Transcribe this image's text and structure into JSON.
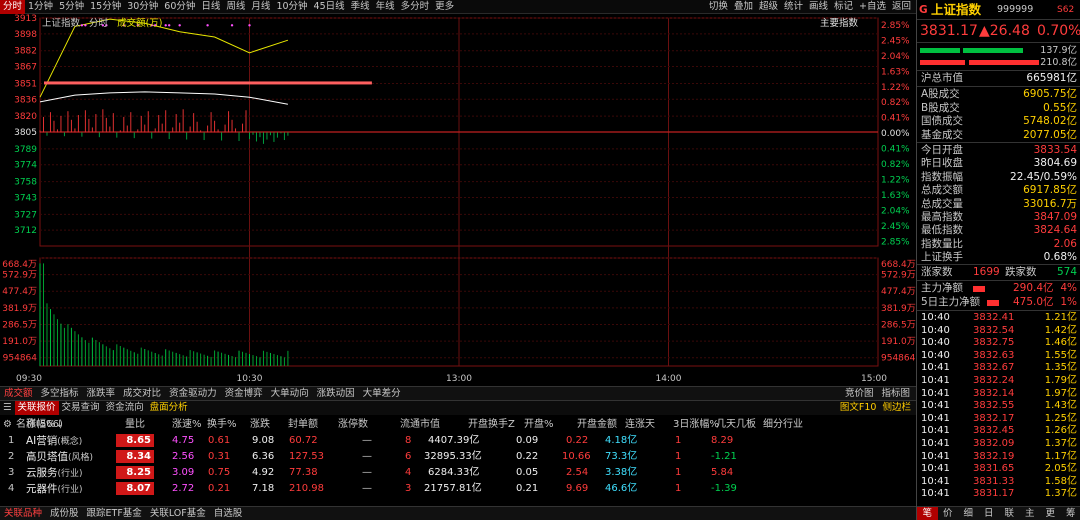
{
  "periods": [
    "分时",
    "1分钟",
    "5分钟",
    "15分钟",
    "30分钟",
    "60分钟",
    "日线",
    "周线",
    "月线",
    "10分钟",
    "45日线",
    "季线",
    "年线",
    "多分时",
    "更多"
  ],
  "active_period": 0,
  "tools": [
    "切换",
    "叠加",
    "超级",
    "统计",
    "画线",
    "标记",
    "+自选",
    "返回"
  ],
  "chart": {
    "legend_name": "上证指数",
    "legend_mode": "分时",
    "legend_vol": "成交额(万)",
    "index_label": "主要指数",
    "price_ticks": [
      "3913",
      "3898",
      "3882",
      "3867",
      "3851",
      "3836",
      "3820",
      "3805",
      "3789",
      "3774",
      "3758",
      "3743",
      "3727",
      "3712"
    ],
    "pct_ticks": [
      "2.85%",
      "2.45%",
      "2.04%",
      "1.63%",
      "1.22%",
      "0.82%",
      "0.41%",
      "0.00%",
      "0.41%",
      "0.82%",
      "1.22%",
      "1.63%",
      "2.04%",
      "2.45%",
      "2.85%"
    ],
    "vol_ticks": [
      "668.4万",
      "572.9万",
      "477.4万",
      "381.9万",
      "286.5万",
      "191.0万",
      "954864"
    ],
    "time_ticks": [
      "09:30",
      "10:30",
      "13:00",
      "14:00",
      "15:00"
    ]
  },
  "chart_data": {
    "type": "line",
    "title": "上证指数",
    "xlabel": "",
    "ylabel": "",
    "prev_close": 3804.69,
    "ylim": [
      3697,
      3913
    ],
    "x": [
      "09:30",
      "09:40",
      "09:50",
      "10:00",
      "10:10",
      "10:20",
      "10:30",
      "10:41"
    ],
    "series": [
      {
        "name": "",
        "color": "#ffffff",
        "values": [
          3833.5,
          3840,
          3842,
          3843,
          3842,
          3841,
          3838,
          3831.2
        ]
      },
      {
        "name": "",
        "color": "#e6e600",
        "values": [
          3838,
          3905,
          3912,
          3908,
          3900,
          3895,
          3880,
          3892
        ]
      }
    ],
    "volume_ylim": [
      0,
      668.4
    ],
    "volume_unit": "万"
  },
  "subtabs": [
    "成交额",
    "多空指标",
    "涨跌率",
    "成交对比",
    "资金驱动力",
    "资金博弈",
    "大单动向",
    "涨跌动因",
    "大单差分"
  ],
  "subtabs_right": [
    "竞价图",
    "指标图"
  ],
  "tabs2": [
    "关联报价",
    "交易查询",
    "资金流向",
    "盘面分析"
  ],
  "tabs2_right": [
    "图文F10",
    "侧边栏"
  ],
  "table": {
    "headers": [
      "名称(566)",
      "涨幅%↓",
      "量比",
      "涨速%",
      "换手%",
      "涨跌",
      "封单额",
      "涨停数",
      "流通市值",
      "开盘换手Z",
      "开盘%",
      "开盘金额",
      "连涨天",
      "3日涨幅%",
      "几天几板",
      "细分行业"
    ],
    "rows": [
      {
        "no": "1",
        "name": "AI营销",
        "tag": "(概念)",
        "chg": "8.65",
        "vr": "4.75",
        "spd": "0.61",
        "turn": "9.08",
        "delta": "60.72",
        "seal": "—",
        "lim": "8",
        "cap": "4407.39亿",
        "oturn": "0.09",
        "opct": "0.22",
        "oamt": "4.18亿",
        "days": "1",
        "d3": "8.29",
        "d3c": "red"
      },
      {
        "no": "2",
        "name": "高贝塔值",
        "tag": "(风格)",
        "chg": "8.34",
        "vr": "2.56",
        "spd": "0.31",
        "turn": "6.36",
        "delta": "127.53",
        "seal": "—",
        "lim": "6",
        "cap": "32895.33亿",
        "oturn": "0.22",
        "opct": "10.66",
        "oamt": "73.3亿",
        "days": "1",
        "d3": "-1.21",
        "d3c": "grn"
      },
      {
        "no": "3",
        "name": "云服务",
        "tag": "(行业)",
        "chg": "8.25",
        "vr": "3.09",
        "spd": "0.75",
        "turn": "4.92",
        "delta": "77.38",
        "seal": "—",
        "lim": "4",
        "cap": "6284.33亿",
        "oturn": "0.05",
        "opct": "2.54",
        "oamt": "3.38亿",
        "days": "1",
        "d3": "5.84",
        "d3c": "red"
      },
      {
        "no": "4",
        "name": "元器件",
        "tag": "(行业)",
        "chg": "8.07",
        "vr": "2.72",
        "spd": "0.21",
        "turn": "7.18",
        "delta": "210.98",
        "seal": "—",
        "lim": "3",
        "cap": "21757.81亿",
        "oturn": "0.21",
        "opct": "9.69",
        "oamt": "46.6亿",
        "days": "1",
        "d3": "-1.39",
        "d3c": "grn"
      }
    ]
  },
  "bottom_tabs": [
    "关联品种",
    "成份股",
    "跟踪ETF基金",
    "关联LOF基金",
    "自选股"
  ],
  "right": {
    "flag": "G",
    "title": "上证指数",
    "code": "999999",
    "sig": "S62",
    "price": "3831.17",
    "change": "▲26.48",
    "pct": "0.70%",
    "bar1_val": "137.9亿",
    "bar2_val": "210.8亿",
    "market_cap_label": "沪总市值",
    "market_cap": "665981亿",
    "vol_rows": [
      {
        "label": "A股成交",
        "value": "6905.75亿"
      },
      {
        "label": "B股成交",
        "value": "0.55亿"
      },
      {
        "label": "国债成交",
        "value": "5748.02亿"
      },
      {
        "label": "基金成交",
        "value": "2077.05亿"
      }
    ],
    "stats": [
      {
        "label": "今日开盘",
        "value": "3833.54",
        "c": "red"
      },
      {
        "label": "昨日收盘",
        "value": "3804.69",
        "c": "wht"
      },
      {
        "label": "指数振幅",
        "value": "22.45/0.59%",
        "c": "wht"
      },
      {
        "label": "总成交额",
        "value": "6917.85亿",
        "c": "yel"
      },
      {
        "label": "总成交量",
        "value": "33016.7万",
        "c": "yel"
      },
      {
        "label": "最高指数",
        "value": "3847.09",
        "c": "red"
      },
      {
        "label": "最低指数",
        "value": "3824.64",
        "c": "red"
      },
      {
        "label": "指数量比",
        "value": "2.06",
        "c": "red"
      },
      {
        "label": "上证换手",
        "value": "0.68%",
        "c": "wht"
      }
    ],
    "up_label": "涨家数",
    "up_count": "1699",
    "down_label": "跌家数",
    "down_count": "574",
    "flow1_label": "主力净额",
    "flow1_val": "290.4亿",
    "flow1_pct": "4%",
    "flow2_label": "5日主力净额",
    "flow2_val": "475.0亿",
    "flow2_pct": "1%",
    "ticks": [
      {
        "t": "10:40",
        "p": "3832.41",
        "pct": "1.21亿"
      },
      {
        "t": "10:40",
        "p": "3832.54",
        "pct": "1.42亿"
      },
      {
        "t": "10:40",
        "p": "3832.75",
        "pct": "1.46亿"
      },
      {
        "t": "10:40",
        "p": "3832.63",
        "pct": "1.55亿"
      },
      {
        "t": "10:41",
        "p": "3832.67",
        "pct": "1.35亿"
      },
      {
        "t": "10:41",
        "p": "3832.24",
        "pct": "1.79亿"
      },
      {
        "t": "10:41",
        "p": "3832.14",
        "pct": "1.97亿"
      },
      {
        "t": "10:41",
        "p": "3832.55",
        "pct": "1.43亿"
      },
      {
        "t": "10:41",
        "p": "3832.17",
        "pct": "1.25亿"
      },
      {
        "t": "10:41",
        "p": "3832.45",
        "pct": "1.26亿"
      },
      {
        "t": "10:41",
        "p": "3832.09",
        "pct": "1.37亿"
      },
      {
        "t": "10:41",
        "p": "3832.19",
        "pct": "1.17亿"
      },
      {
        "t": "10:41",
        "p": "3831.65",
        "pct": "2.05亿"
      },
      {
        "t": "10:41",
        "p": "3831.33",
        "pct": "1.58亿"
      },
      {
        "t": "10:41",
        "p": "3831.17",
        "pct": "1.37亿"
      }
    ],
    "bottom_tabs": [
      "笔",
      "价",
      "细",
      "日",
      "联",
      "主",
      "更",
      "筹"
    ]
  }
}
